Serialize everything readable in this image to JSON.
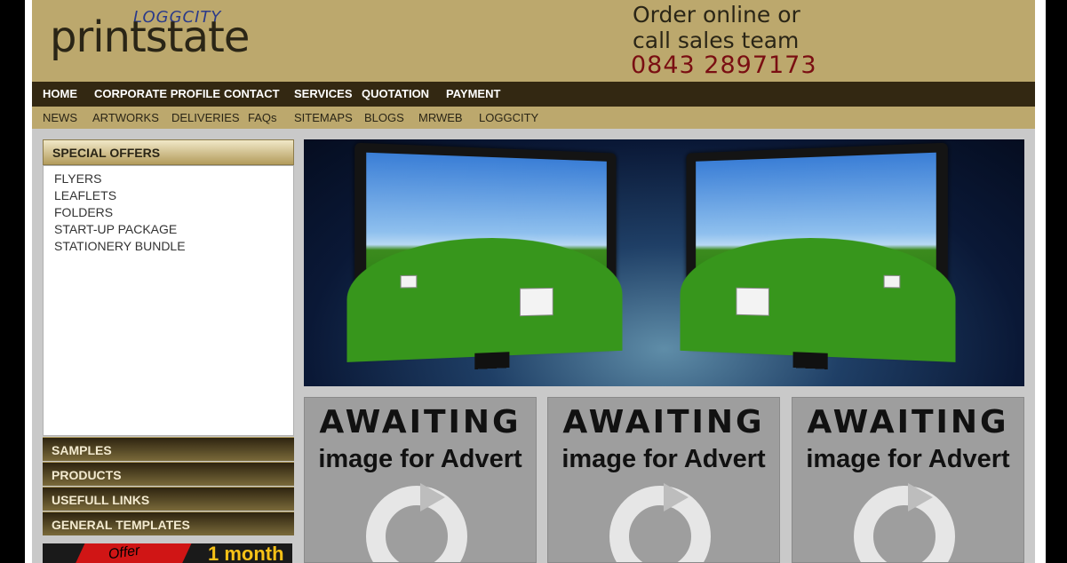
{
  "header": {
    "logo_small": "LOGGCITY",
    "logo_main": "printstate",
    "order_line1": "Order online or",
    "order_line2": "call sales team",
    "phone": "0843 2897173"
  },
  "main_nav": [
    "HOME",
    "CORPORATE PROFILE",
    "CONTACT",
    "SERVICES",
    "QUOTATION",
    "PAYMENT"
  ],
  "sub_nav": [
    "NEWS",
    "ARTWORKS",
    "DELIVERIES",
    "FAQs",
    "SITEMAPS",
    "BLOGS",
    "MRWEB",
    "LOGGCITY"
  ],
  "sidebar": {
    "special_offers_title": "SPECIAL OFFERS",
    "special_offers": [
      "FLYERS",
      "LEAFLETS",
      "FOLDERS",
      "START-UP PACKAGE",
      "STATIONERY BUNDLE"
    ],
    "sections": [
      "SAMPLES",
      "PRODUCTS",
      "USEFULL LINKS",
      "GENERAL TEMPLATES"
    ],
    "promo_offer": "Offer",
    "promo_month": "1 month"
  },
  "adverts": [
    {
      "line1": "AWAITING",
      "line2": "image for Advert"
    },
    {
      "line1": "AWAITING",
      "line2": "image for Advert"
    },
    {
      "line1": "AWAITING",
      "line2": "image for Advert"
    }
  ],
  "colors": {
    "header_bg": "#bca86d",
    "nav_bg": "#332812",
    "phone": "#7a0e12"
  }
}
